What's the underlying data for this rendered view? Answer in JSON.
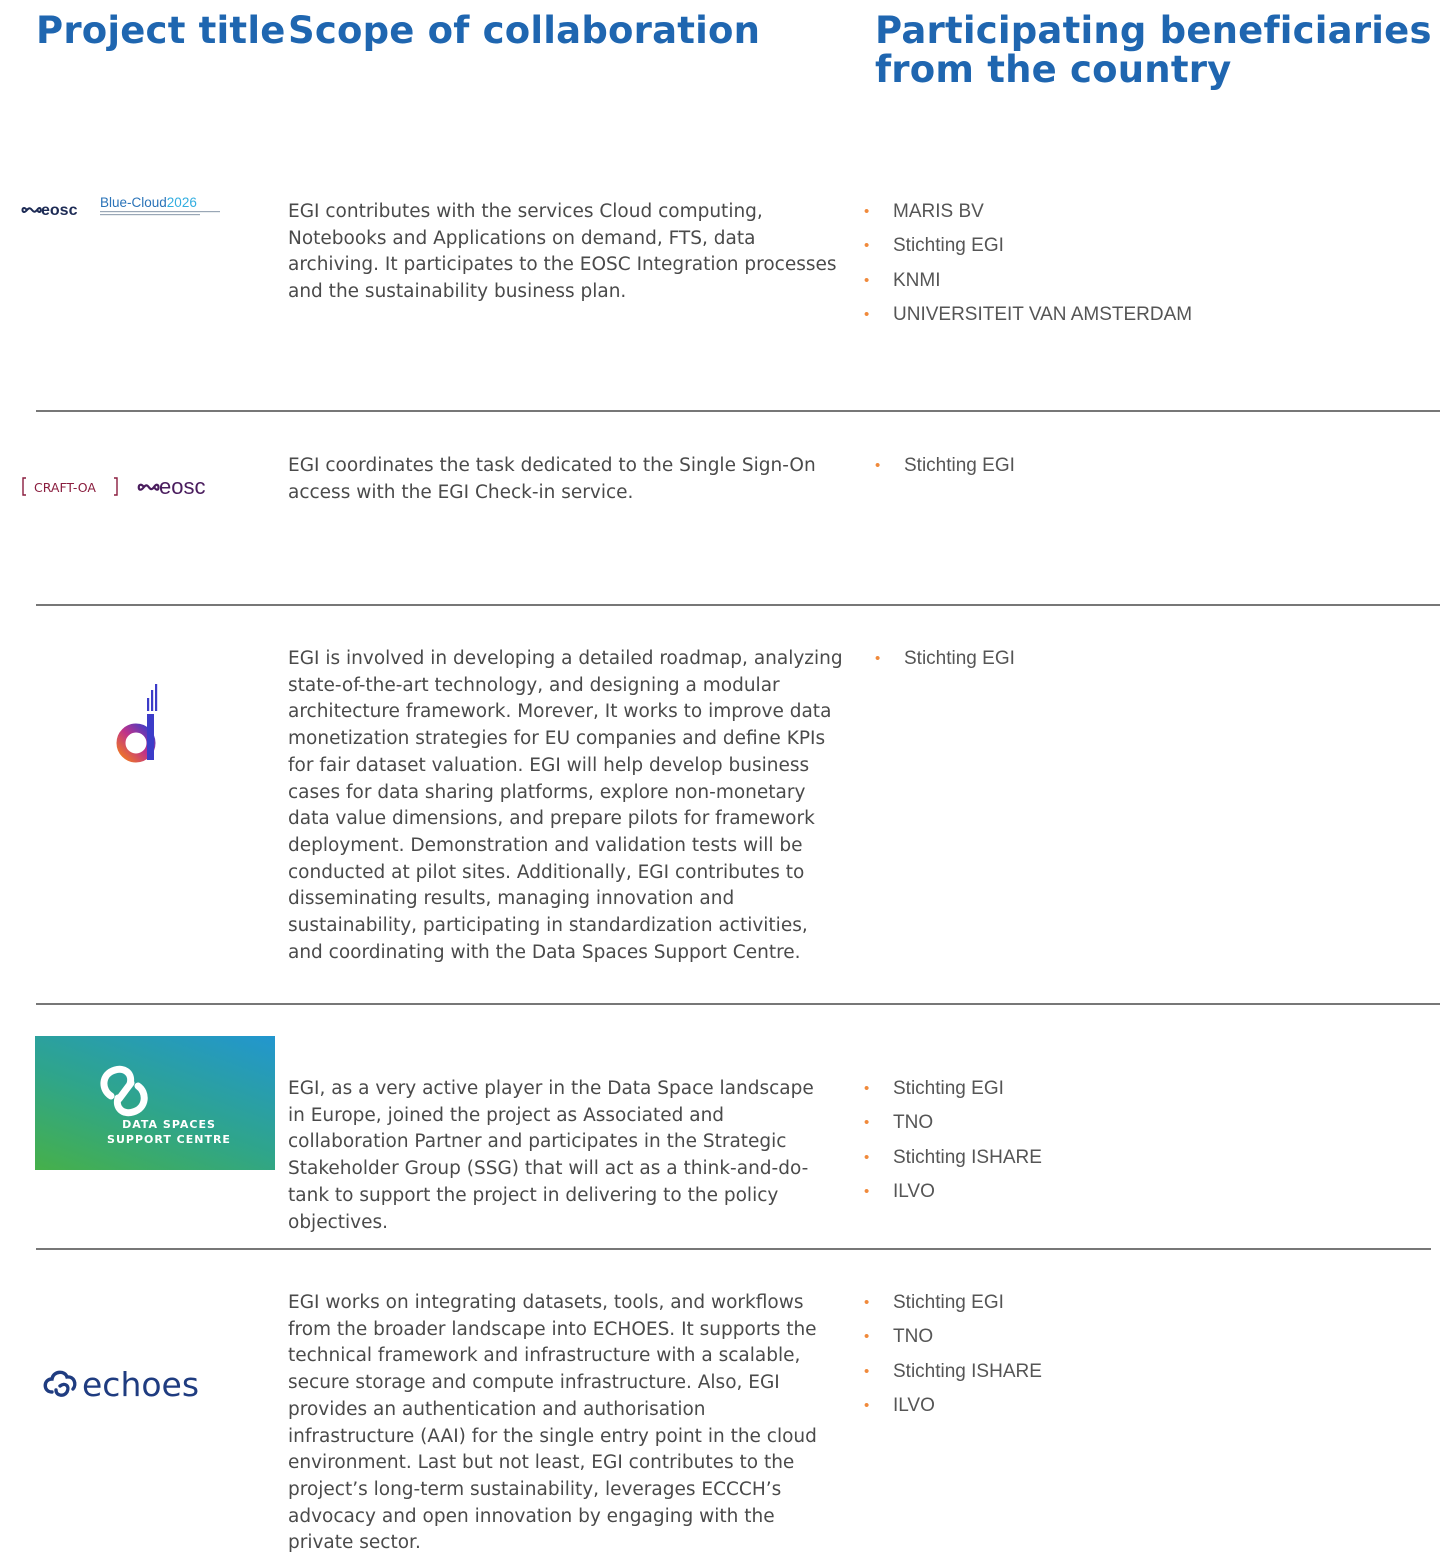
{
  "headers": {
    "project_title": "Project title",
    "scope": "Scope of collaboration",
    "beneficiaries_line1": "Participating beneficiaries",
    "beneficiaries_line2": "from the country"
  },
  "colors": {
    "heading": "#1f66b0",
    "bullet": "#f08a3c",
    "body_text": "#4a4a4a",
    "divider": "#777777"
  },
  "rows": [
    {
      "logos": [
        "eosc",
        "Blue-Cloud2026"
      ],
      "logo_text": {
        "eosc": "eosc",
        "blue": "Blue-Cloud",
        "year": "2026"
      },
      "scope": "EGI contributes with the services Cloud computing, Notebooks and Applications on demand, FTS, data archiving. It participates to the EOSC Integration processes and the sustainability business plan.",
      "beneficiaries": [
        "MARIS BV",
        "Stichting EGI",
        "KNMI",
        "UNIVERSITEIT VAN AMSTERDAM"
      ]
    },
    {
      "logos": [
        "CRAFT-OA",
        "eosc"
      ],
      "logo_text": {
        "craft": "CRAFT-OA",
        "eosc": "eosc"
      },
      "scope": "EGI coordinates the task dedicated to the Single Sign-On access with the EGI Check-in service.",
      "beneficiaries": [
        "Stichting EGI"
      ]
    },
    {
      "logos": [
        "d-gradient-logo"
      ],
      "scope": "EGI is involved in developing a detailed roadmap, analyzing state-of-the-art technology, and designing a modular architecture framework. Morever, It works to improve data monetization strategies for EU companies and define KPIs for fair dataset valuation. EGI will help develop business cases for data sharing platforms, explore non-monetary data value dimensions, and prepare pilots for framework deployment. Demonstration and validation tests will be conducted at pilot sites. Additionally, EGI contributes to disseminating results, managing innovation and sustainability, participating in standardization activities, and coordinating with the Data Spaces Support Centre.",
      "beneficiaries": [
        "Stichting EGI"
      ]
    },
    {
      "logos": [
        "Data Spaces Support Centre"
      ],
      "logo_text": {
        "line1": "DATA SPACES",
        "line2": "SUPPORT CENTRE"
      },
      "scope": "EGI, as a very active player in the Data Space landscape in Europe, joined the project as Associated and collaboration Partner and participates in the Strategic Stakeholder Group (SSG) that will act as a think-and-do-tank to support the project in delivering to the policy objectives.",
      "beneficiaries": [
        "Stichting EGI",
        "TNO",
        "Stichting ISHARE",
        "ILVO"
      ]
    },
    {
      "logos": [
        "echoes"
      ],
      "logo_text": {
        "name": "echoes"
      },
      "scope": "EGI works on integrating datasets, tools, and workflows from the broader landscape into ECHOES. It supports the technical framework and infrastructure with a scalable, secure storage and compute infrastructure. Also, EGI provides an authentication and authorisation infrastructure (AAI) for the single entry point in the cloud environment. Last but not least, EGI contributes to the project’s long-term sustainability, leverages ECCCH’s advocacy and open innovation by engaging with the private sector.",
      "beneficiaries": [
        "Stichting EGI",
        "TNO",
        "Stichting ISHARE",
        "ILVO"
      ]
    }
  ]
}
